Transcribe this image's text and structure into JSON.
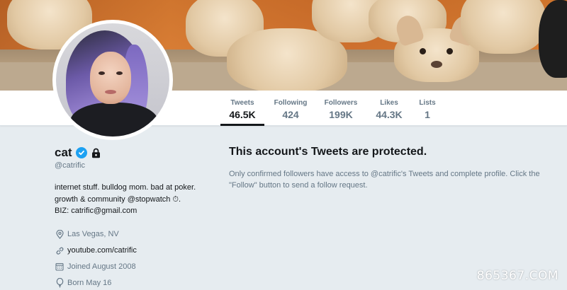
{
  "navbar": {
    "tabs": [
      {
        "label": "Tweets",
        "value": "46.5K"
      },
      {
        "label": "Following",
        "value": "424"
      },
      {
        "label": "Followers",
        "value": "199K"
      },
      {
        "label": "Likes",
        "value": "44.3K"
      },
      {
        "label": "Lists",
        "value": "1"
      }
    ],
    "active_tab": "Tweets"
  },
  "profile": {
    "name": "cat",
    "handle": "@catrific",
    "bio_lines": [
      "internet stuff. bulldog mom. bad at poker.",
      "growth & community @stopwatch",
      "BIZ: catrific@gmail.com"
    ],
    "bio_emoji": "⏱",
    "bio_emoji_suffix": ".",
    "location": "Las Vegas, NV",
    "website": "youtube.com/catrific",
    "joined": "Joined August 2008",
    "birthday": "Born May 16"
  },
  "protected": {
    "title": "This account's Tweets are protected.",
    "text": "Only confirmed followers have access to @catrific's Tweets and complete profile. Click the \"Follow\" button to send a follow request."
  },
  "watermark": "865367.COM",
  "colors": {
    "background": "#e6ecf0",
    "verified": "#1da1f2",
    "muted_text": "#657786",
    "primary_text": "#14171a"
  },
  "icons": [
    "verified-badge-icon",
    "lock-icon",
    "location-pin-icon",
    "link-icon",
    "calendar-icon",
    "balloon-icon"
  ]
}
